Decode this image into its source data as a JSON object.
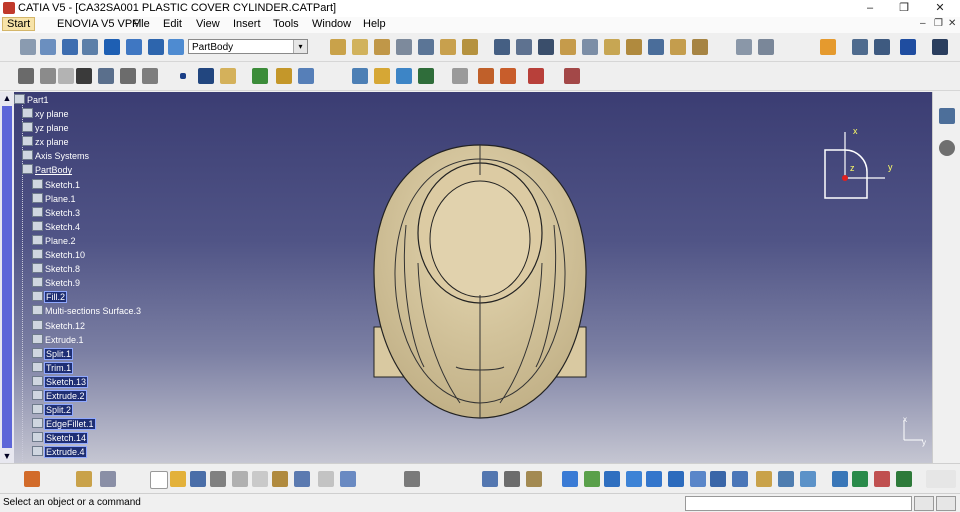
{
  "window": {
    "title": "CATIA V5 - [CA32SA001 PLASTIC COVER CYLINDER.CATPart]",
    "minimize": "–",
    "restore": "❐",
    "close": "✕"
  },
  "menu": {
    "items": [
      "Start",
      "ENOVIA V5 VPM",
      "File",
      "Edit",
      "View",
      "Insert",
      "Tools",
      "Window",
      "Help"
    ],
    "doc_controls": [
      "–",
      "❐",
      "✕"
    ]
  },
  "toolbar": {
    "combo_value": "PartBody",
    "combo_arrow": "▾"
  },
  "tree": {
    "root": "Part1",
    "items": [
      {
        "label": "xy plane",
        "level": 1,
        "icon": "plane-icon"
      },
      {
        "label": "yz plane",
        "level": 1,
        "icon": "plane-icon"
      },
      {
        "label": "zx plane",
        "level": 1,
        "icon": "plane-icon"
      },
      {
        "label": "Axis Systems",
        "level": 1,
        "icon": "axis-system-icon"
      },
      {
        "label": "PartBody",
        "level": 1,
        "icon": "partbody-icon",
        "underline": true
      },
      {
        "label": "Sketch.1",
        "level": 2,
        "icon": "sketch-icon"
      },
      {
        "label": "Plane.1",
        "level": 2,
        "icon": "plane-icon"
      },
      {
        "label": "Sketch.3",
        "level": 2,
        "icon": "sketch-icon"
      },
      {
        "label": "Sketch.4",
        "level": 2,
        "icon": "sketch-icon"
      },
      {
        "label": "Plane.2",
        "level": 2,
        "icon": "plane-icon"
      },
      {
        "label": "Sketch.10",
        "level": 2,
        "icon": "sketch-icon"
      },
      {
        "label": "Sketch.8",
        "level": 2,
        "icon": "sketch-icon"
      },
      {
        "label": "Sketch.9",
        "level": 2,
        "icon": "sketch-icon"
      },
      {
        "label": "Fill.2",
        "level": 2,
        "icon": "fill-icon",
        "selected": true
      },
      {
        "label": "Multi-sections Surface.3",
        "level": 2,
        "icon": "multi-section-icon"
      },
      {
        "label": "Sketch.12",
        "level": 2,
        "icon": "sketch-icon"
      },
      {
        "label": "Extrude.1",
        "level": 2,
        "icon": "extrude-icon"
      },
      {
        "label": "Split.1",
        "level": 2,
        "icon": "split-icon",
        "selected": true
      },
      {
        "label": "Trim.1",
        "level": 2,
        "icon": "trim-icon",
        "selected": true
      },
      {
        "label": "Sketch.13",
        "level": 2,
        "icon": "sketch-icon",
        "selected": true
      },
      {
        "label": "Extrude.2",
        "level": 2,
        "icon": "extrude-icon",
        "selected": true
      },
      {
        "label": "Split.2",
        "level": 2,
        "icon": "split-icon",
        "selected": true
      },
      {
        "label": "EdgeFillet.1",
        "level": 2,
        "icon": "edge-fillet-icon",
        "selected": true
      },
      {
        "label": "Sketch.14",
        "level": 2,
        "icon": "sketch-icon",
        "selected": true
      },
      {
        "label": "Extrude.4",
        "level": 2,
        "icon": "extrude-icon",
        "selected": true
      }
    ]
  },
  "compass": {
    "x": "x",
    "y": "y",
    "z": "z"
  },
  "axis_mini": {
    "x": "x",
    "y": "y"
  },
  "status": {
    "message": "Select an object or a command"
  },
  "scroll": {
    "up": "▲",
    "down": "▼"
  },
  "colors": {
    "viewport_top": "#3b3d73",
    "viewport_bottom": "#c5c6d2",
    "model": "#d9c9a1",
    "selection": "#1f2f74"
  }
}
